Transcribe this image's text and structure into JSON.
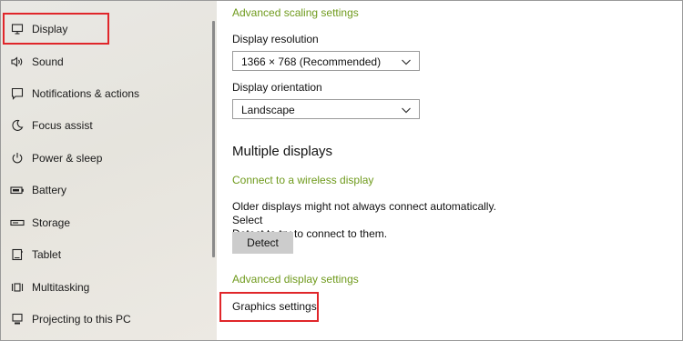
{
  "sidebar": {
    "items": [
      {
        "label": "Display",
        "icon": "monitor-icon"
      },
      {
        "label": "Sound",
        "icon": "speaker-icon"
      },
      {
        "label": "Notifications & actions",
        "icon": "notification-icon"
      },
      {
        "label": "Focus assist",
        "icon": "moon-icon"
      },
      {
        "label": "Power & sleep",
        "icon": "power-icon"
      },
      {
        "label": "Battery",
        "icon": "battery-icon"
      },
      {
        "label": "Storage",
        "icon": "storage-icon"
      },
      {
        "label": "Tablet",
        "icon": "tablet-icon"
      },
      {
        "label": "Multitasking",
        "icon": "multitasking-icon"
      },
      {
        "label": "Projecting to this PC",
        "icon": "projecting-icon"
      }
    ],
    "selected": "Display"
  },
  "main": {
    "advanced_scaling_link": "Advanced scaling settings",
    "resolution": {
      "label": "Display resolution",
      "value": "1366 × 768 (Recommended)"
    },
    "orientation": {
      "label": "Display orientation",
      "value": "Landscape"
    },
    "multiple_displays": {
      "heading": "Multiple displays",
      "wireless_link": "Connect to a wireless display",
      "description_line1": "Older displays might not always connect automatically. Select",
      "description_line2": "Detect to try to connect to them.",
      "detect_button": "Detect"
    },
    "advanced_display_link": "Advanced display settings",
    "graphics_settings_link": "Graphics settings"
  },
  "colors": {
    "link": "#6f9a1c",
    "highlight": "#e0262a",
    "button_bg": "#cccccc",
    "sidebar_bg": "#e8e6e1"
  }
}
